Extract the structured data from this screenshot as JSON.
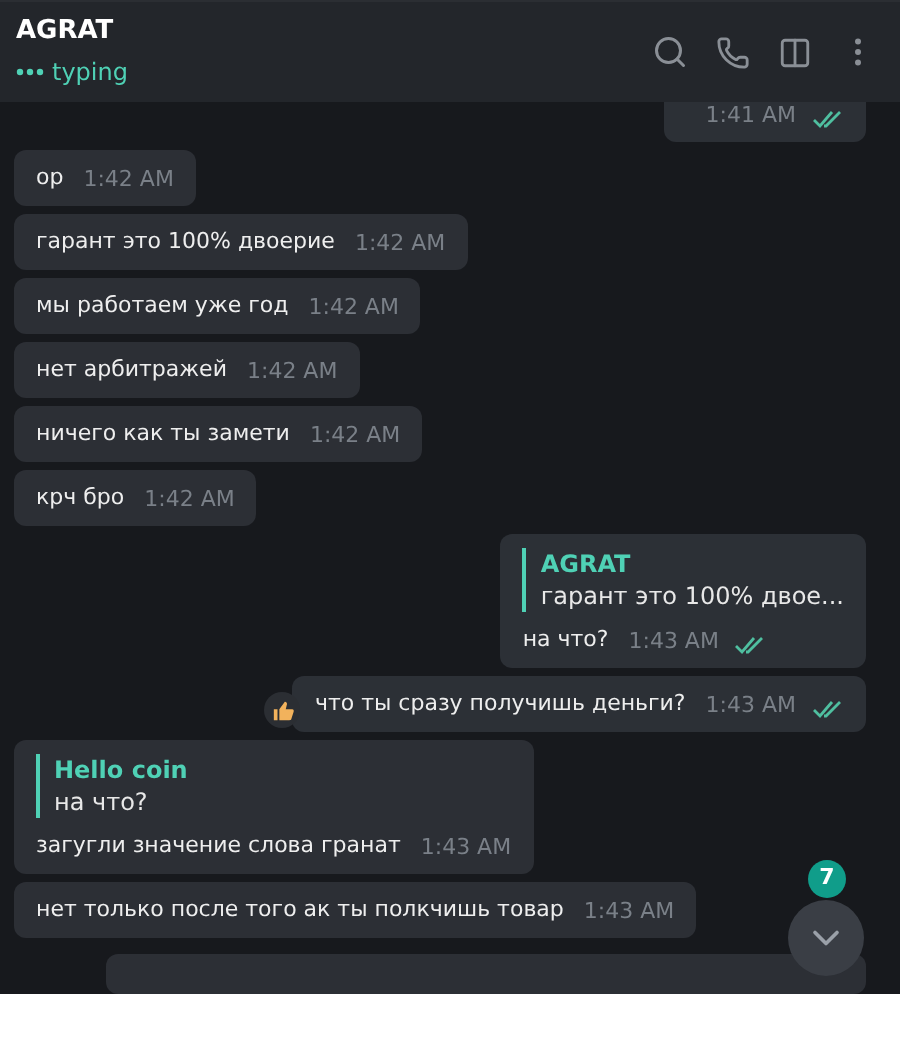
{
  "header": {
    "title": "AGRAT",
    "status": "typing"
  },
  "messages": [
    {
      "kind": "out",
      "time": "1:41 AM",
      "read": true
    },
    {
      "kind": "in",
      "text": "ор",
      "time": "1:42 AM"
    },
    {
      "kind": "in",
      "text": "гарант это 100% двоерие",
      "time": "1:42 AM"
    },
    {
      "kind": "in",
      "text": "мы работаем уже год",
      "time": "1:42 AM"
    },
    {
      "kind": "in",
      "text": "нет арбитражей",
      "time": "1:42 AM"
    },
    {
      "kind": "in",
      "text": "ничего как ты замети",
      "time": "1:42 AM"
    },
    {
      "kind": "in",
      "text": "крч бро",
      "time": "1:42 AM"
    },
    {
      "kind": "out",
      "reply": {
        "author": "AGRAT",
        "text": "гарант это 100% двое..."
      },
      "text": "на что?",
      "time": "1:43 AM",
      "read": true
    },
    {
      "kind": "out",
      "text": "что ты сразу получишь деньги?",
      "time": "1:43 AM",
      "read": true,
      "reaction": true
    },
    {
      "kind": "in",
      "reply": {
        "author": "Hello coin",
        "text": "на что?"
      },
      "text": "загугли значение слова гранат",
      "time": "1:43 AM"
    },
    {
      "kind": "in",
      "text": "нет только после того ак ты полкчишь товар",
      "time": "1:43 AM"
    }
  ],
  "unread_badge": "7"
}
